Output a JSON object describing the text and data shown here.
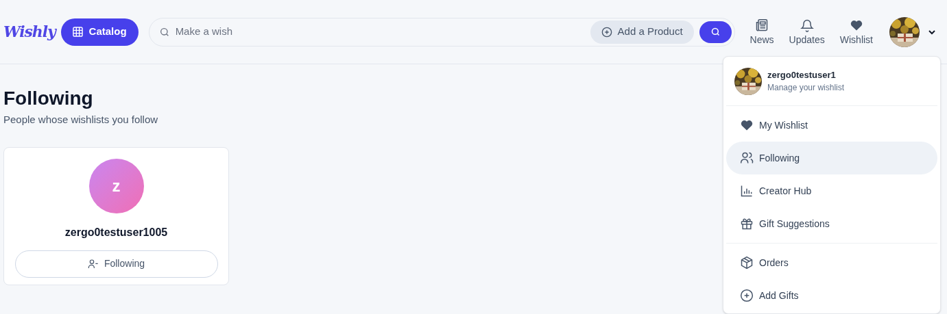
{
  "header": {
    "logo": "Wishly",
    "catalog_button": "Catalog",
    "search": {
      "placeholder": "Make a wish"
    },
    "add_product_button": "Add a Product",
    "nav": [
      {
        "kind": "news",
        "label": "News"
      },
      {
        "kind": "bell",
        "label": "Updates"
      },
      {
        "kind": "heart",
        "label": "Wishlist"
      }
    ]
  },
  "page": {
    "title": "Following",
    "subtitle": "People whose wishlists you follow",
    "people": [
      {
        "initial": "z",
        "username": "zergo0testuser1005",
        "button": "Following"
      }
    ]
  },
  "user_menu": {
    "username": "zergo0testuser1",
    "caption": "Manage your wishlist",
    "sections": [
      [
        {
          "kind": "heart",
          "label": "My Wishlist",
          "selected": false
        },
        {
          "kind": "users",
          "label": "Following",
          "selected": true
        },
        {
          "kind": "chart",
          "label": "Creator Hub",
          "selected": false
        },
        {
          "kind": "gift",
          "label": "Gift Suggestions",
          "selected": false
        }
      ],
      [
        {
          "kind": "box",
          "label": "Orders",
          "selected": false
        },
        {
          "kind": "plus",
          "label": "Add Gifts",
          "selected": false
        }
      ]
    ]
  }
}
